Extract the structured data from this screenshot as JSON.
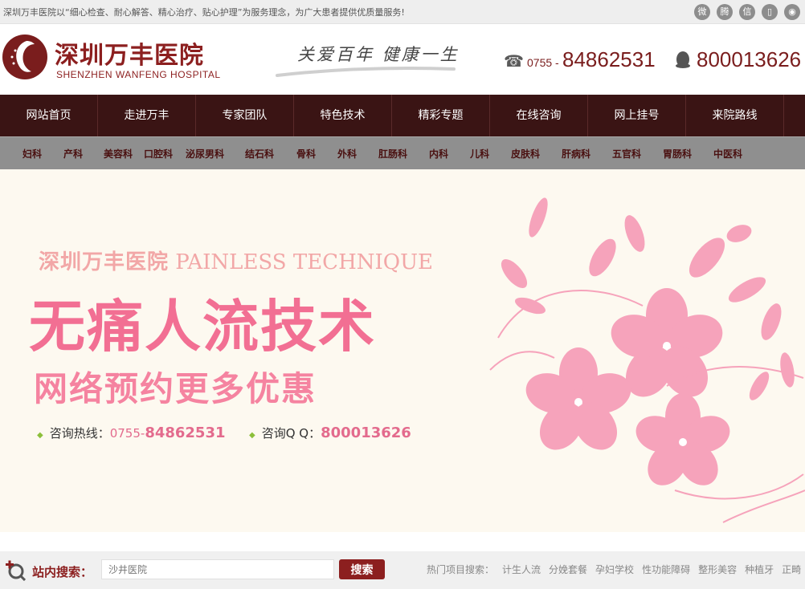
{
  "topbar": {
    "notice": "深圳万丰医院以“细心检查、耐心解答、精心治疗、贴心护理”为服务理念，为广大患者提供优质量服务!",
    "social_icons": [
      "weibo-icon",
      "tencent-weibo-icon",
      "wechat-icon",
      "mobile-icon",
      "location-icon"
    ]
  },
  "header": {
    "logo_cn": "深圳万丰医院",
    "logo_en": "SHENZHEN WANFENG HOSPITAL",
    "slogan": "关爱百年 健康一生",
    "phone_prefix": "0755 -",
    "phone_number": "84862531",
    "qq_number": "800013626"
  },
  "mainnav": [
    "网站首页",
    "走进万丰",
    "专家团队",
    "特色技术",
    "精彩专题",
    "在线咨询",
    "网上挂号",
    "来院路线"
  ],
  "subnav": [
    "妇科",
    "产科",
    "美容科",
    "口腔科",
    "泌尿男科",
    "结石科",
    "骨科",
    "外科",
    "肛肠科",
    "内科",
    "儿科",
    "皮肤科",
    "肝病科",
    "五官科",
    "胃肠科",
    "中医科"
  ],
  "banner": {
    "title_cn": "深圳万丰医院",
    "title_en": "PAINLESS TECHNIQUE",
    "main": "无痛人流技术",
    "sub": "网络预约更多优惠",
    "hotline_label": "咨询热线：",
    "hotline_prefix": "0755-",
    "hotline_number": "84862531",
    "qq_label": "咨询Q Q：",
    "qq_number": "800013626"
  },
  "search": {
    "label": "站内搜索：",
    "placeholder": "沙井医院",
    "button": "搜索",
    "hot_label": "热门项目搜索：",
    "hot_items": [
      "计生人流",
      "分娩套餐",
      "孕妇学校",
      "性功能障碍",
      "整形美容",
      "种植牙",
      "正畸"
    ]
  },
  "colors": {
    "brand": "#8c1f1f",
    "nav_bg": "#3a1414",
    "subnav_bg": "#8f8f8f",
    "banner_pink": "#f26f93",
    "banner_bg": "#fdf9f0"
  }
}
